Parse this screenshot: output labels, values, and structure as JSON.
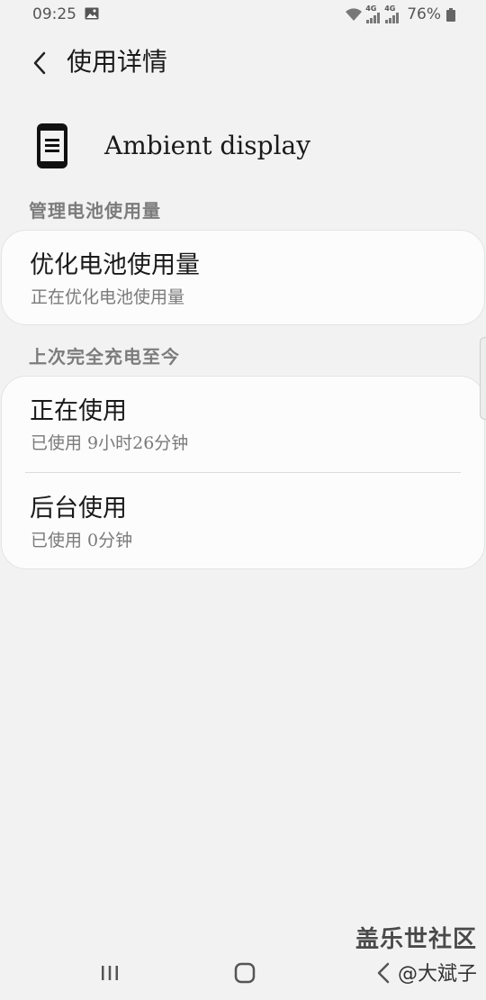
{
  "status_bar": {
    "time": "09:25",
    "network_1": "4G",
    "network_2": "4G",
    "battery": "76%"
  },
  "header": {
    "title": "使用详情"
  },
  "app": {
    "name": "Ambient display",
    "icon": "phone-screen-icon"
  },
  "sections": {
    "manage_battery": {
      "header": "管理电池使用量",
      "item_title": "优化电池使用量",
      "item_subtitle": "正在优化电池使用量"
    },
    "since_full_charge": {
      "header": "上次完全充电至今",
      "active_title": "正在使用",
      "active_subtitle": "已使用 9小时26分钟",
      "background_title": "后台使用",
      "background_subtitle": "已使用 0分钟"
    }
  },
  "watermark": {
    "line1": "盖乐世社区",
    "line2": "@大斌子"
  },
  "nav": {
    "recent_icon": "recent-apps-icon",
    "home_icon": "home-icon",
    "back_icon": "back-icon"
  },
  "colors": {
    "background": "#f2f2f2",
    "card": "#fcfcfc",
    "section_header": "#7c7c7c",
    "subtitle": "#7a7a7a"
  }
}
